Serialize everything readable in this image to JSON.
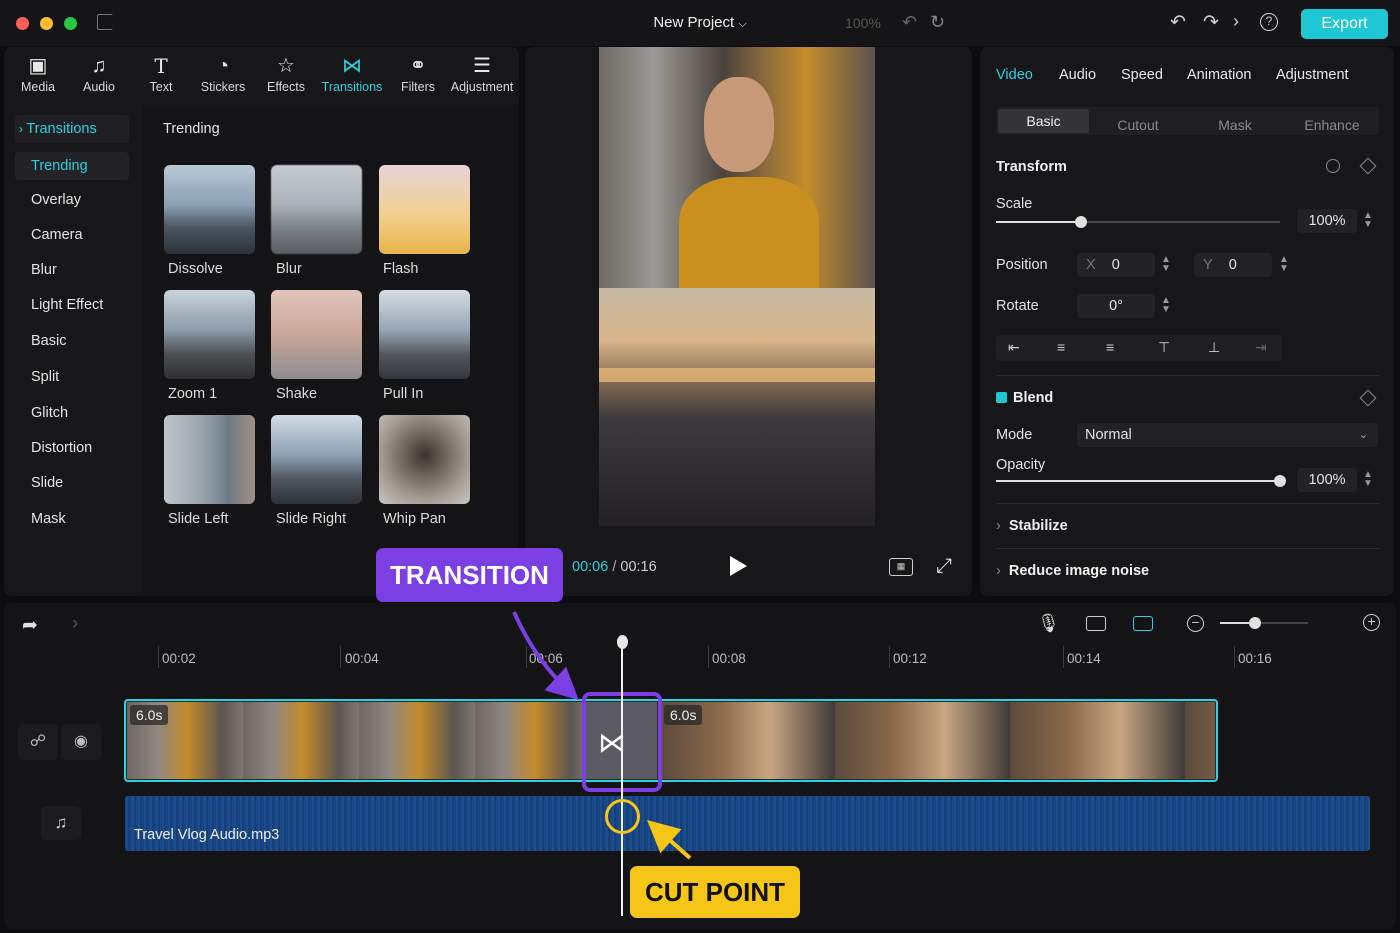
{
  "titlebar": {
    "project_title": "New Project",
    "zoom_faded": "100%",
    "export_label": "Export"
  },
  "toolbar": {
    "tools": [
      {
        "label": "Media",
        "icon": "media-icon"
      },
      {
        "label": "Audio",
        "icon": "music-note-icon"
      },
      {
        "label": "Text",
        "icon": "text-icon"
      },
      {
        "label": "Stickers",
        "icon": "sticker-icon"
      },
      {
        "label": "Effects",
        "icon": "star-icon"
      },
      {
        "label": "Transitions",
        "icon": "transition-icon",
        "active": true
      },
      {
        "label": "Filters",
        "icon": "filters-icon"
      },
      {
        "label": "Adjustment",
        "icon": "sliders-icon"
      }
    ]
  },
  "sidebar": {
    "header": "Transitions",
    "items": [
      "Trending",
      "Overlay",
      "Camera",
      "Blur",
      "Light Effect",
      "Basic",
      "Split",
      "Glitch",
      "Distortion",
      "Slide",
      "Mask"
    ]
  },
  "library": {
    "section_title": "Trending",
    "items": [
      "Dissolve",
      "Blur",
      "Flash",
      "Zoom 1",
      "Shake",
      "Pull In",
      "Slide Left",
      "Slide Right",
      "Whip Pan"
    ]
  },
  "player": {
    "current_time": "00:06",
    "separator": "/",
    "total_time": "00:16"
  },
  "properties": {
    "tabs": [
      "Video",
      "Audio",
      "Speed",
      "Animation",
      "Adjustment"
    ],
    "subtabs": [
      "Basic",
      "Cutout",
      "Mask",
      "Enhance"
    ],
    "transform_title": "Transform",
    "scale_label": "Scale",
    "scale_value": "100%",
    "scale_level": 0.3,
    "position_label": "Position",
    "x_label": "X",
    "x_value": "0",
    "y_label": "Y",
    "y_value": "0",
    "rotate_label": "Rotate",
    "rotate_value": "0°",
    "blend_title": "Blend",
    "mode_label": "Mode",
    "mode_value": "Normal",
    "opacity_label": "Opacity",
    "opacity_value": "100%",
    "opacity_level": 1.0,
    "stabilize_label": "Stabilize",
    "noise_label": "Reduce image noise"
  },
  "timeline": {
    "ruler": [
      "00:02",
      "00:04",
      "00:06",
      "00:08",
      "00:12",
      "00:14",
      "00:16"
    ],
    "clip1_duration": "6.0s",
    "clip2_duration": "6.0s",
    "audio_name": "Travel Vlog Audio.mp3"
  },
  "callouts": {
    "transition": "TRANSITION",
    "cut_point": "CUT POINT"
  },
  "colors": {
    "accent": "#1fc7d4",
    "transition_purple": "#7b3fe4",
    "cut_yellow": "#f5c518",
    "audio_blue": "#17407a"
  }
}
